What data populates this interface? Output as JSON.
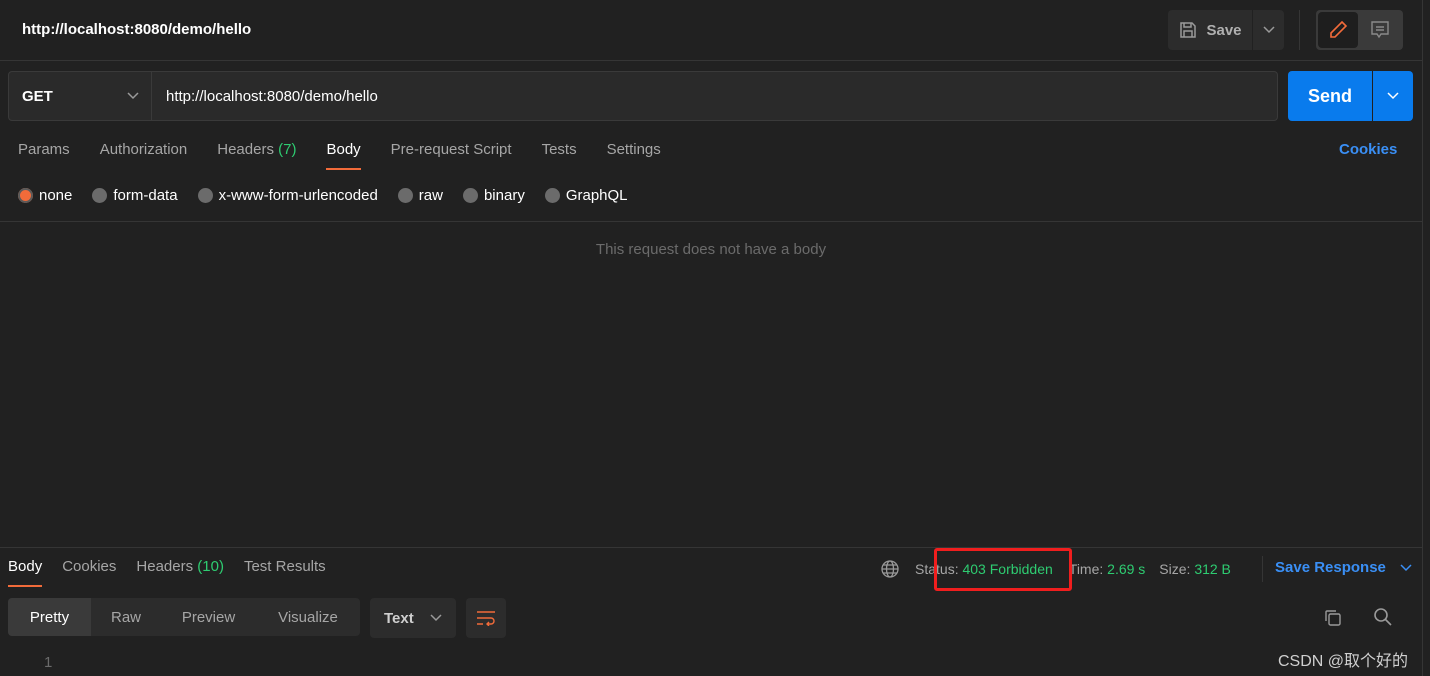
{
  "header": {
    "title": "http://localhost:8080/demo/hello",
    "save_label": "Save"
  },
  "request": {
    "method": "GET",
    "url": "http://localhost:8080/demo/hello",
    "send_label": "Send"
  },
  "tabs": [
    {
      "label": "Params"
    },
    {
      "label": "Authorization"
    },
    {
      "label": "Headers",
      "count": "(7)"
    },
    {
      "label": "Body",
      "active": true
    },
    {
      "label": "Pre-request Script"
    },
    {
      "label": "Tests"
    },
    {
      "label": "Settings"
    }
  ],
  "cookies_label": "Cookies",
  "body_types": [
    "none",
    "form-data",
    "x-www-form-urlencoded",
    "raw",
    "binary",
    "GraphQL"
  ],
  "selected_body_type": "none",
  "empty_body_text": "This request does not have a body",
  "response": {
    "tabs": [
      {
        "label": "Body"
      },
      {
        "label": "Cookies"
      },
      {
        "label": "Headers",
        "count": "(10)"
      },
      {
        "label": "Test Results"
      }
    ],
    "status_label": "Status:",
    "status": "403 Forbidden",
    "time_label": "Time:",
    "time": "2.69 s",
    "size_label": "Size:",
    "size": "312 B",
    "save_response_label": "Save Response",
    "views": [
      "Pretty",
      "Raw",
      "Preview",
      "Visualize"
    ],
    "format": "Text",
    "line_number": "1"
  },
  "watermark": "CSDN @取个好的",
  "colors": {
    "accent": "#f26b3a",
    "primary": "#097bed",
    "success": "#2ecc71",
    "highlight_box": "#f01e1e"
  }
}
